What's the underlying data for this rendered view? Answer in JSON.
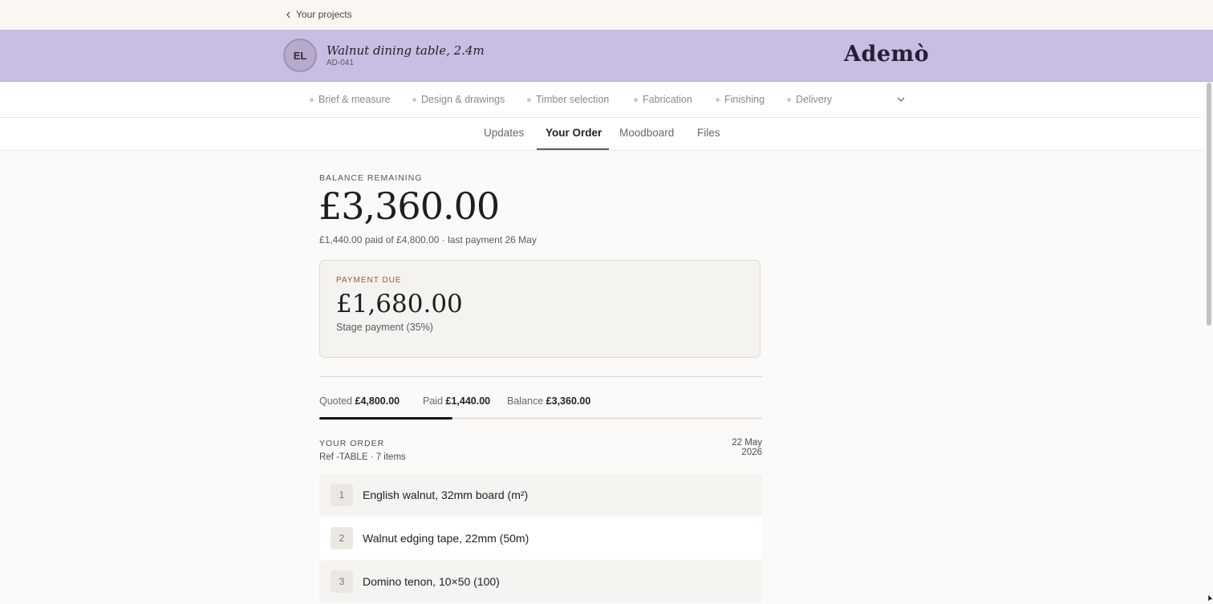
{
  "nav": {
    "back_label": "Your projects"
  },
  "project": {
    "initials": "EL",
    "title": "Walnut dining table, 2.4m",
    "code": "AD-041",
    "brand": "Ademò"
  },
  "stages": [
    {
      "label": "Brief & measure"
    },
    {
      "label": "Design & drawings"
    },
    {
      "label": "Timber selection"
    },
    {
      "label": "Fabrication"
    },
    {
      "label": "Finishing"
    },
    {
      "label": "Delivery"
    }
  ],
  "tabs": [
    {
      "label": "Updates"
    },
    {
      "label": "Your Order",
      "active": true
    },
    {
      "label": "Moodboard"
    },
    {
      "label": "Files"
    }
  ],
  "balance": {
    "label": "BALANCE REMAINING",
    "amount": "£3,360.00",
    "sub": "£1,440.00 paid of £4,800.00 · last payment 26 May"
  },
  "payment_due": {
    "label": "PAYMENT DUE",
    "amount": "£1,680.00",
    "description": "Stage payment (35%)"
  },
  "summary": {
    "quoted_label": "Quoted",
    "quoted_value": "£4,800.00",
    "paid_label": "Paid",
    "paid_value": "£1,440.00",
    "balance_label": "Balance",
    "balance_value": "£3,360.00",
    "paid_fraction": 0.3
  },
  "order": {
    "label": "YOUR ORDER",
    "date": "22 May 2026",
    "meta": "Ref -TABLE · 7 items",
    "items": [
      {
        "number": "1",
        "name": "English walnut, 32mm board (m²)"
      },
      {
        "number": "2",
        "name": "Walnut edging tape, 22mm (50m)"
      },
      {
        "number": "3",
        "name": "Domino tenon, 10×50 (100)"
      }
    ]
  },
  "colors": {
    "header_bg": "#c8bde2",
    "accent_due": "#9a5a32",
    "progress_fill": "#141316"
  }
}
